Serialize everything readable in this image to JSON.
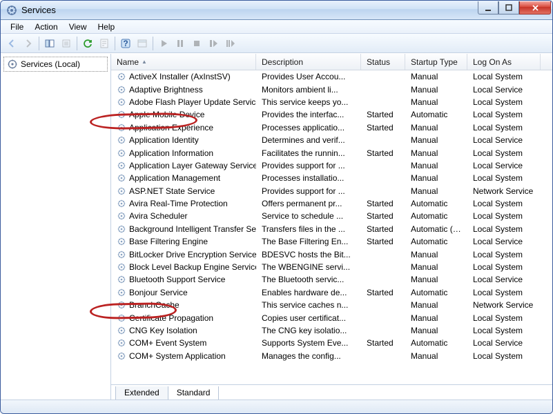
{
  "window": {
    "title": "Services"
  },
  "menu": {
    "file": "File",
    "action": "Action",
    "view": "View",
    "help": "Help"
  },
  "tree": {
    "root": "Services (Local)"
  },
  "columns": {
    "name": "Name",
    "description": "Description",
    "status": "Status",
    "startup": "Startup Type",
    "logon": "Log On As"
  },
  "tabs": {
    "extended": "Extended",
    "standard": "Standard"
  },
  "services": [
    {
      "name": "ActiveX Installer (AxInstSV)",
      "desc": "Provides User Accou...",
      "status": "",
      "startup": "Manual",
      "logon": "Local System"
    },
    {
      "name": "Adaptive Brightness",
      "desc": "Monitors ambient li...",
      "status": "",
      "startup": "Manual",
      "logon": "Local Service"
    },
    {
      "name": "Adobe Flash Player Update Service",
      "desc": "This service keeps yo...",
      "status": "",
      "startup": "Manual",
      "logon": "Local System"
    },
    {
      "name": "Apple Mobile Device",
      "desc": "Provides the interfac...",
      "status": "Started",
      "startup": "Automatic",
      "logon": "Local System"
    },
    {
      "name": "Application Experience",
      "desc": "Processes applicatio...",
      "status": "Started",
      "startup": "Manual",
      "logon": "Local System"
    },
    {
      "name": "Application Identity",
      "desc": "Determines and verif...",
      "status": "",
      "startup": "Manual",
      "logon": "Local Service"
    },
    {
      "name": "Application Information",
      "desc": "Facilitates the runnin...",
      "status": "Started",
      "startup": "Manual",
      "logon": "Local System"
    },
    {
      "name": "Application Layer Gateway Service",
      "desc": "Provides support for ...",
      "status": "",
      "startup": "Manual",
      "logon": "Local Service"
    },
    {
      "name": "Application Management",
      "desc": "Processes installatio...",
      "status": "",
      "startup": "Manual",
      "logon": "Local System"
    },
    {
      "name": "ASP.NET State Service",
      "desc": "Provides support for ...",
      "status": "",
      "startup": "Manual",
      "logon": "Network Service"
    },
    {
      "name": "Avira Real-Time Protection",
      "desc": "Offers permanent pr...",
      "status": "Started",
      "startup": "Automatic",
      "logon": "Local System"
    },
    {
      "name": "Avira Scheduler",
      "desc": "Service to schedule ...",
      "status": "Started",
      "startup": "Automatic",
      "logon": "Local System"
    },
    {
      "name": "Background Intelligent Transfer Service",
      "desc": "Transfers files in the ...",
      "status": "Started",
      "startup": "Automatic (D...",
      "logon": "Local System"
    },
    {
      "name": "Base Filtering Engine",
      "desc": "The Base Filtering En...",
      "status": "Started",
      "startup": "Automatic",
      "logon": "Local Service"
    },
    {
      "name": "BitLocker Drive Encryption Service",
      "desc": "BDESVC hosts the Bit...",
      "status": "",
      "startup": "Manual",
      "logon": "Local System"
    },
    {
      "name": "Block Level Backup Engine Service",
      "desc": "The WBENGINE servi...",
      "status": "",
      "startup": "Manual",
      "logon": "Local System"
    },
    {
      "name": "Bluetooth Support Service",
      "desc": "The Bluetooth servic...",
      "status": "",
      "startup": "Manual",
      "logon": "Local Service"
    },
    {
      "name": "Bonjour Service",
      "desc": "Enables hardware de...",
      "status": "Started",
      "startup": "Automatic",
      "logon": "Local System"
    },
    {
      "name": "BranchCache",
      "desc": "This service caches n...",
      "status": "",
      "startup": "Manual",
      "logon": "Network Service"
    },
    {
      "name": "Certificate Propagation",
      "desc": "Copies user certificat...",
      "status": "",
      "startup": "Manual",
      "logon": "Local System"
    },
    {
      "name": "CNG Key Isolation",
      "desc": "The CNG key isolatio...",
      "status": "",
      "startup": "Manual",
      "logon": "Local System"
    },
    {
      "name": "COM+ Event System",
      "desc": "Supports System Eve...",
      "status": "Started",
      "startup": "Automatic",
      "logon": "Local Service"
    },
    {
      "name": "COM+ System Application",
      "desc": "Manages the config...",
      "status": "",
      "startup": "Manual",
      "logon": "Local System"
    }
  ]
}
